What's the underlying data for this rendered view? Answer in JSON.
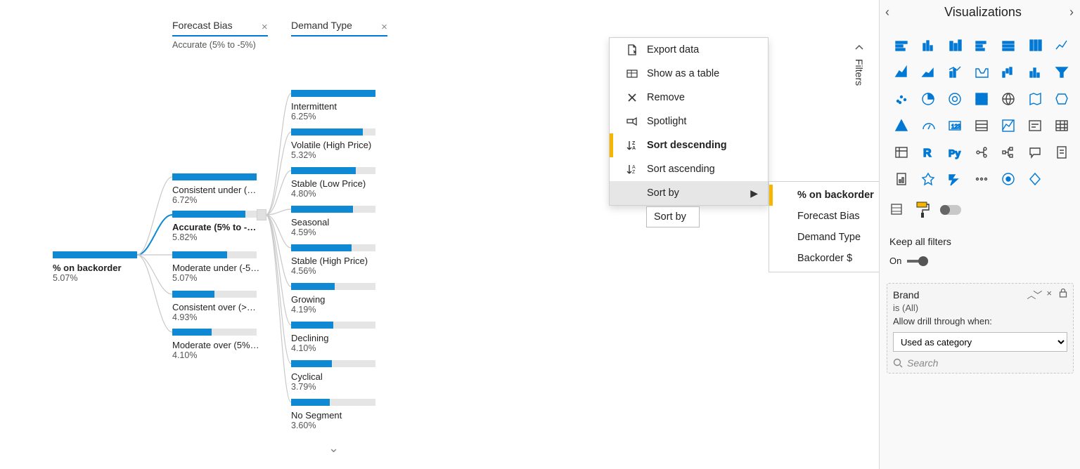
{
  "columns": {
    "c1": {
      "label": "Forecast Bias",
      "selected": "Accurate (5% to -5%)"
    },
    "c2": {
      "label": "Demand Type"
    }
  },
  "root": {
    "label": "% on backorder",
    "pct": "5.07%"
  },
  "forecast": [
    {
      "label": "Consistent under (<-2...",
      "pct": "6.72%",
      "fill": 100
    },
    {
      "label": "Accurate (5% to -5%)",
      "pct": "5.82%",
      "fill": 87,
      "bold": true,
      "handle": true
    },
    {
      "label": "Moderate under (-5% ...",
      "pct": "5.07%",
      "fill": 65
    },
    {
      "label": "Consistent over (>20%)",
      "pct": "4.93%",
      "fill": 50
    },
    {
      "label": "Moderate over (5% to ...",
      "pct": "4.10%",
      "fill": 47
    }
  ],
  "demand": [
    {
      "label": "Intermittent",
      "pct": "6.25%",
      "fill": 100
    },
    {
      "label": "Volatile (High Price)",
      "pct": "5.32%",
      "fill": 85
    },
    {
      "label": "Stable (Low Price)",
      "pct": "4.80%",
      "fill": 77
    },
    {
      "label": "Seasonal",
      "pct": "4.59%",
      "fill": 73
    },
    {
      "label": "Stable (High Price)",
      "pct": "4.56%",
      "fill": 72
    },
    {
      "label": "Growing",
      "pct": "4.19%",
      "fill": 52
    },
    {
      "label": "Declining",
      "pct": "4.10%",
      "fill": 50
    },
    {
      "label": "Cyclical",
      "pct": "3.79%",
      "fill": 48
    },
    {
      "label": "No Segment",
      "pct": "3.60%",
      "fill": 46
    }
  ],
  "context_menu": {
    "export": "Export data",
    "table": "Show as a table",
    "remove": "Remove",
    "spot": "Spotlight",
    "sort_desc": "Sort descending",
    "sort_asc": "Sort ascending",
    "sort_by": "Sort by",
    "tooltip": "Sort by"
  },
  "sortby_options": [
    "% on backorder",
    "Forecast Bias",
    "Demand Type",
    "Backorder $"
  ],
  "filters_tab": "Filters",
  "vis": {
    "title": "Visualizations",
    "keep_all": "Keep all filters",
    "keep_on": "On",
    "brand_title": "Brand",
    "brand_value": "is (All)",
    "brand_allow": "Allow drill through when:",
    "brand_select": "Used as category",
    "search_ph": "Search"
  }
}
